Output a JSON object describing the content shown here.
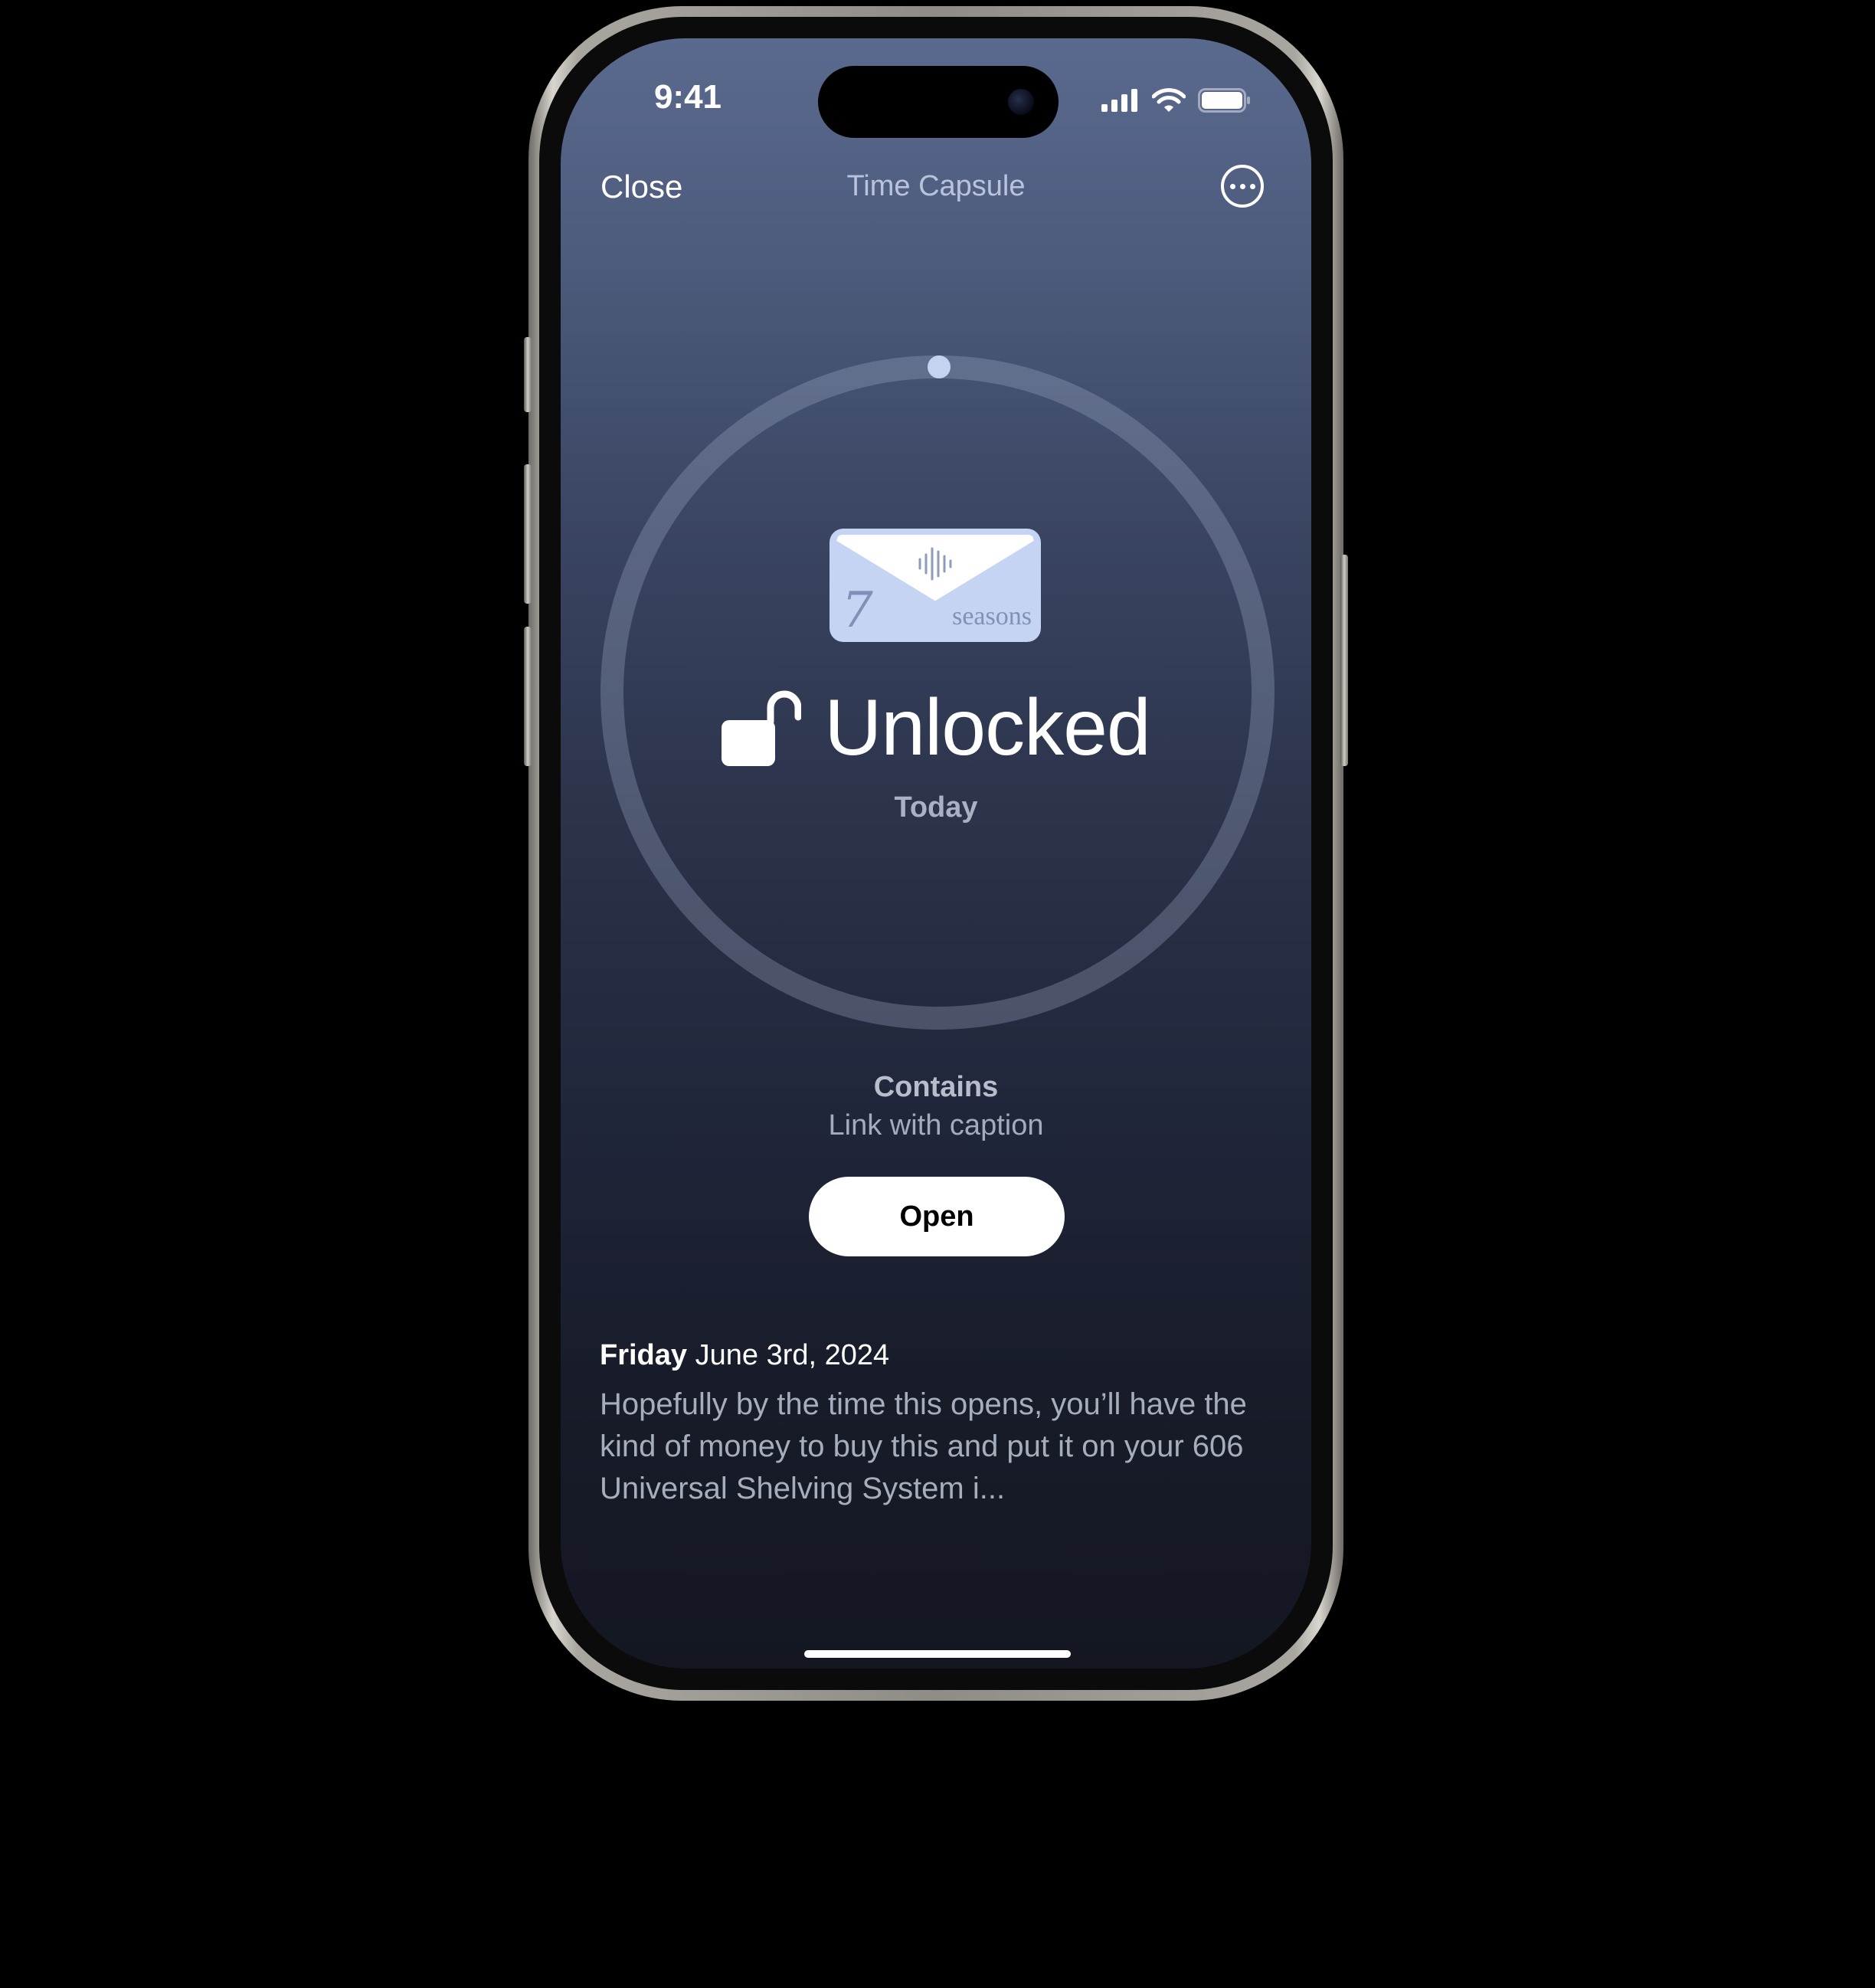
{
  "status_bar": {
    "time": "9:41",
    "icons": [
      "cellular-signal-icon",
      "wifi-icon",
      "battery-icon"
    ]
  },
  "nav": {
    "close_label": "Close",
    "title": "Time Capsule",
    "more_icon": "ellipsis-circle-icon"
  },
  "capsule": {
    "envelope_icon": "envelope-audio-icon",
    "envelope_brand_number": "7",
    "envelope_brand_word": "seasons",
    "lock_icon": "unlocked-padlock-icon",
    "status": "Unlocked",
    "status_sub": "Today",
    "contains_label": "Contains",
    "contains_value": "Link with caption",
    "open_label": "Open"
  },
  "note": {
    "day": "Friday",
    "date": "June 3rd, 2024",
    "body": "Hopefully by the time this opens, you’ll have the kind of money to buy this and put it on your 606 Universal Shelving System i..."
  },
  "colors": {
    "background_top": "#5a6a8e",
    "background_bottom": "#141722",
    "accent": "#c5d3f0",
    "envelope": "#c5d4f2",
    "button_bg": "#ffffff"
  }
}
